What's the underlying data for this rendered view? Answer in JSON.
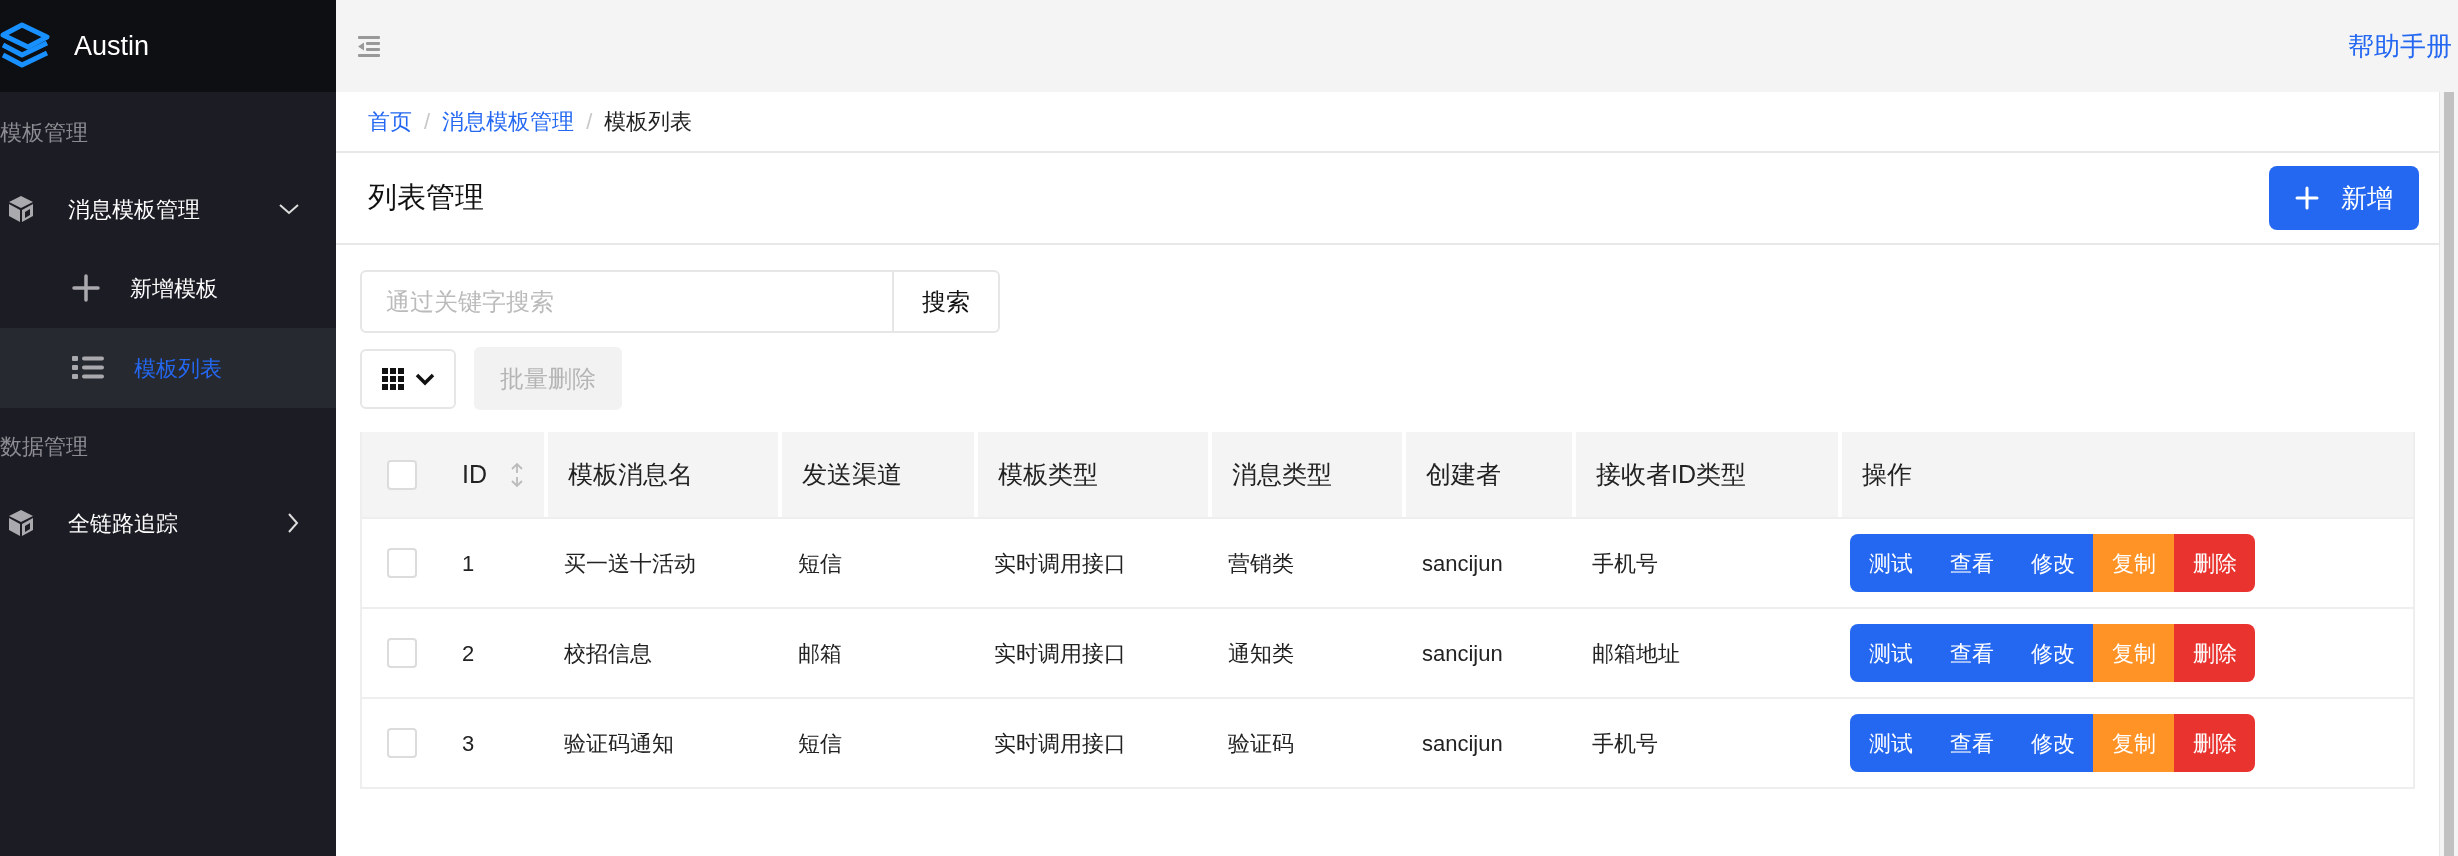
{
  "app": {
    "name": "Austin"
  },
  "sidebar": {
    "groups": [
      {
        "label": "模板管理",
        "items": [
          {
            "label": "消息模板管理",
            "kind": "cube",
            "expanded": true,
            "children": [
              {
                "label": "新增模板",
                "kind": "plus",
                "selected": false
              },
              {
                "label": "模板列表",
                "kind": "list",
                "selected": true
              }
            ]
          }
        ]
      },
      {
        "label": "数据管理",
        "items": [
          {
            "label": "全链路追踪",
            "kind": "cube",
            "expanded": false
          }
        ]
      }
    ]
  },
  "header": {
    "help_link": "帮助手册"
  },
  "breadcrumb": [
    {
      "label": "首页",
      "current": false,
      "separator": "/"
    },
    {
      "label": "消息模板管理",
      "current": false,
      "separator": "/"
    },
    {
      "label": "模板列表",
      "current": true
    }
  ],
  "page": {
    "title": "列表管理",
    "add_button": "新增"
  },
  "search": {
    "placeholder": "通过关键字搜索",
    "button": "搜索"
  },
  "toolbar": {
    "batch_delete": {
      "label": "批量删除",
      "disabled": true
    }
  },
  "table": {
    "select_all_checked": false,
    "columns": [
      {
        "label": "ID",
        "sortable": true
      },
      {
        "label": "模板消息名",
        "sortable": false
      },
      {
        "label": "发送渠道",
        "sortable": false
      },
      {
        "label": "模板类型",
        "sortable": false
      },
      {
        "label": "消息类型",
        "sortable": false
      },
      {
        "label": "创建者",
        "sortable": false
      },
      {
        "label": "接收者ID类型",
        "sortable": false
      },
      {
        "label": "操作",
        "sortable": false
      }
    ],
    "rows": [
      {
        "checked": false,
        "cells": [
          "1",
          "买一送十活动",
          "短信",
          "实时调用接口",
          "营销类",
          "sancijun",
          "手机号"
        ],
        "actions": [
          {
            "label": "测试",
            "kind": "primary"
          },
          {
            "label": "查看",
            "kind": "primary"
          },
          {
            "label": "修改",
            "kind": "primary"
          },
          {
            "label": "复制",
            "kind": "warning"
          },
          {
            "label": "删除",
            "kind": "danger"
          }
        ]
      },
      {
        "checked": false,
        "cells": [
          "2",
          "校招信息",
          "邮箱",
          "实时调用接口",
          "通知类",
          "sancijun",
          "邮箱地址"
        ],
        "actions": [
          {
            "label": "测试",
            "kind": "primary"
          },
          {
            "label": "查看",
            "kind": "primary"
          },
          {
            "label": "修改",
            "kind": "primary"
          },
          {
            "label": "复制",
            "kind": "warning"
          },
          {
            "label": "删除",
            "kind": "danger"
          }
        ]
      },
      {
        "checked": false,
        "cells": [
          "3",
          "验证码通知",
          "短信",
          "实时调用接口",
          "验证码",
          "sancijun",
          "手机号"
        ],
        "actions": [
          {
            "label": "测试",
            "kind": "primary"
          },
          {
            "label": "查看",
            "kind": "primary"
          },
          {
            "label": "修改",
            "kind": "primary"
          },
          {
            "label": "复制",
            "kind": "warning"
          },
          {
            "label": "删除",
            "kind": "danger"
          }
        ]
      }
    ]
  }
}
